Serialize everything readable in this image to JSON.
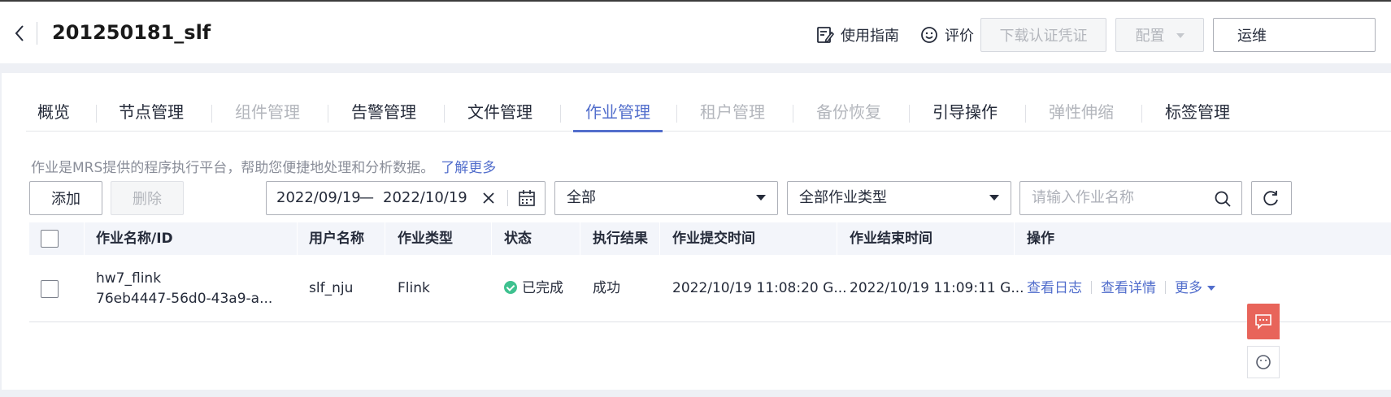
{
  "header": {
    "title": "201250181_slf",
    "guide_label": "使用指南",
    "rate_label": "评价",
    "download_cert_label": "下载认证凭证",
    "config_label": "配置",
    "ops_label": "运维"
  },
  "tabs": [
    {
      "label": "概览",
      "state": "normal"
    },
    {
      "label": "节点管理",
      "state": "normal"
    },
    {
      "label": "组件管理",
      "state": "disabled"
    },
    {
      "label": "告警管理",
      "state": "normal"
    },
    {
      "label": "文件管理",
      "state": "normal"
    },
    {
      "label": "作业管理",
      "state": "active"
    },
    {
      "label": "租户管理",
      "state": "disabled"
    },
    {
      "label": "备份恢复",
      "state": "disabled"
    },
    {
      "label": "引导操作",
      "state": "normal"
    },
    {
      "label": "弹性伸缩",
      "state": "disabled"
    },
    {
      "label": "标签管理",
      "state": "normal"
    }
  ],
  "description": {
    "text": "作业是MRS提供的程序执行平台，帮助您便捷地处理和分析数据。",
    "link": "了解更多"
  },
  "toolbar": {
    "add_label": "添加",
    "delete_label": "删除",
    "date_start": "2022/09/19",
    "date_sep": "—",
    "date_end": "2022/10/19",
    "status_select": "全部",
    "type_select": "全部作业类型",
    "search_placeholder": "请输入作业名称"
  },
  "table": {
    "columns": [
      "作业名称/ID",
      "用户名称",
      "作业类型",
      "状态",
      "执行结果",
      "作业提交时间",
      "作业结束时间",
      "操作"
    ],
    "rows": [
      {
        "name": "hw7_flink",
        "id": "76eb4447-56d0-43a9-a...",
        "user": "slf_nju",
        "type": "Flink",
        "status": "已完成",
        "result": "成功",
        "submit_time": "2022/10/19 11:08:20 G...",
        "end_time": "2022/10/19 11:09:11 G...",
        "actions": {
          "log": "查看日志",
          "detail": "查看详情",
          "more": "更多"
        }
      }
    ]
  },
  "colors": {
    "accent": "#526ecc",
    "success": "#3ec18f",
    "float_button": "#e8645a"
  }
}
